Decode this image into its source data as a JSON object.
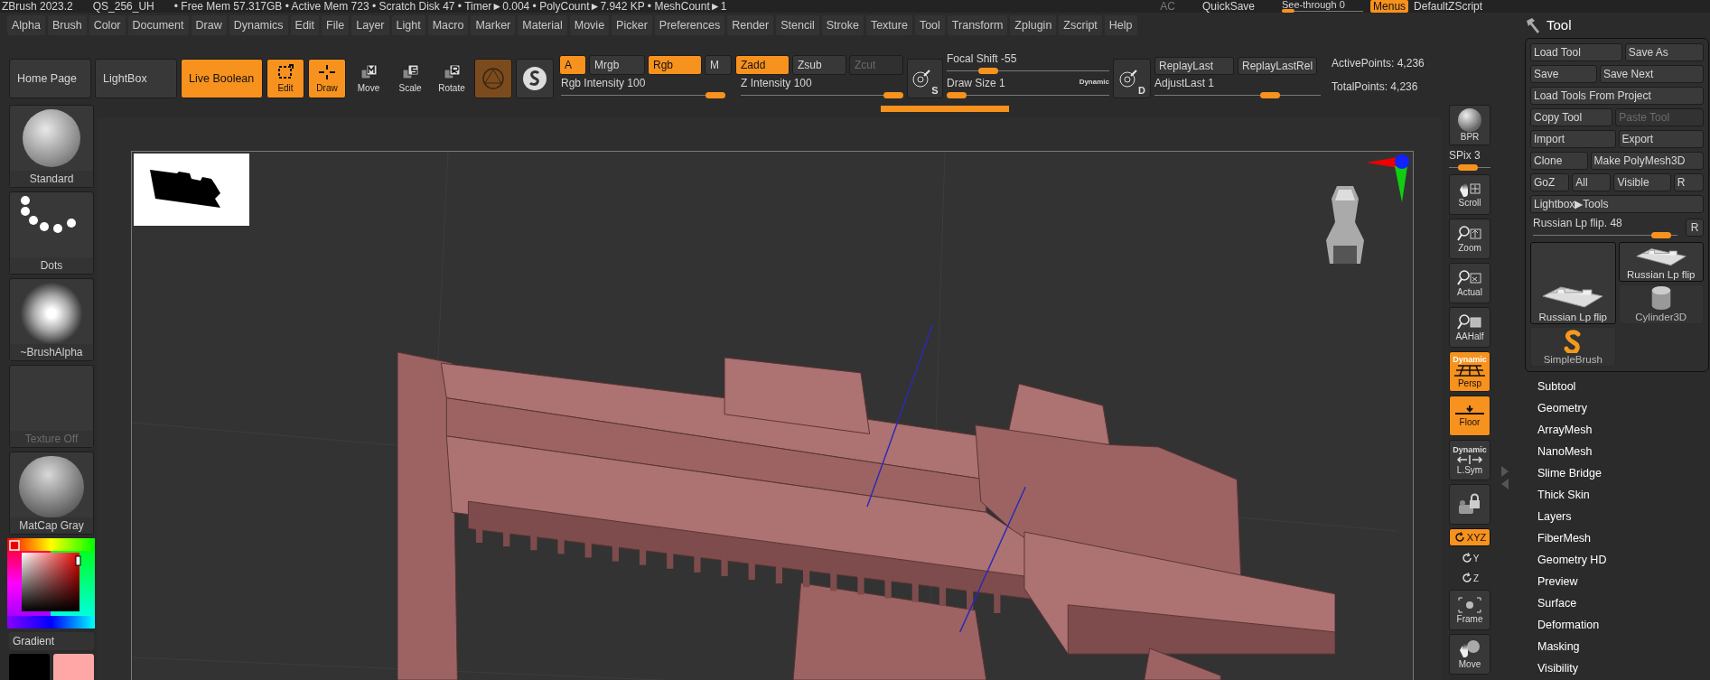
{
  "title_bar": {
    "app": "ZBrush 2023.2",
    "document": "QS_256_UH",
    "stats": "• Free Mem 57.317GB • Active Mem 723 • Scratch Disk 47 • Timer►0.004 • PolyCount►7.942 KP • MeshCount►1",
    "ac": "AC",
    "quicksave": "QuickSave",
    "see_through": {
      "label": "See-through  0",
      "level": 0
    },
    "menus": {
      "label": "Menus",
      "on": true
    },
    "script": "DefaultZScript"
  },
  "menu_bar": [
    "Alpha",
    "Brush",
    "Color",
    "Document",
    "Draw",
    "Dynamics",
    "Edit",
    "File",
    "Layer",
    "Light",
    "Macro",
    "Marker",
    "Material",
    "Movie",
    "Picker",
    "Preferences",
    "Render",
    "Stencil",
    "Stroke",
    "Texture",
    "Tool",
    "Transform",
    "Zplugin",
    "Zscript",
    "Help"
  ],
  "palette_title": "Tool",
  "shelf": {
    "nav": [
      {
        "label": "Home Page",
        "on": false
      },
      {
        "label": "LightBox",
        "on": false
      },
      {
        "label": "Live Boolean",
        "on": true
      }
    ],
    "modes": [
      {
        "kind": "edit",
        "label": "Edit",
        "on": true
      },
      {
        "kind": "draw",
        "label": "Draw",
        "on": true
      },
      {
        "kind": "move",
        "label": "Move",
        "on": false
      },
      {
        "kind": "scale",
        "label": "Scale",
        "on": false
      },
      {
        "kind": "rotate",
        "label": "Rotate",
        "on": false
      }
    ],
    "rgb_channels": [
      {
        "label": "A",
        "on": true,
        "disabled": false
      },
      {
        "label": "Mrgb",
        "on": false,
        "disabled": false
      },
      {
        "label": "Rgb",
        "on": true,
        "disabled": false
      },
      {
        "label": "M",
        "on": false,
        "disabled": false
      }
    ],
    "z_channels": [
      {
        "label": "Zadd",
        "on": true,
        "disabled": false
      },
      {
        "label": "Zsub",
        "on": false,
        "disabled": false
      },
      {
        "label": "Zcut",
        "on": false,
        "disabled": true
      }
    ],
    "rgb_intensity": {
      "label": "Rgb Intensity 100",
      "level": 1
    },
    "z_intensity": {
      "label": "Z Intensity 100",
      "level": 1
    },
    "focal_icon_letter": "S",
    "focal_shift": {
      "label": "Focal Shift -55",
      "level": 0.22
    },
    "draw_size": {
      "label": "Draw Size 1",
      "level": 0,
      "badge": "Dynamic"
    },
    "size_icon_letter": "D",
    "replay": [
      "ReplayLast",
      "ReplayLastRel"
    ],
    "adjust_last": {
      "label": "AdjustLast 1",
      "level": 0.72
    },
    "stats": [
      "ActivePoints: 4,236",
      "TotalPoints: 4,236"
    ]
  },
  "left_shelf": [
    {
      "kind": "brush",
      "label": "Standard",
      "disabled": false
    },
    {
      "kind": "stroke",
      "label": "Dots",
      "disabled": false
    },
    {
      "kind": "alpha",
      "label": "~BrushAlpha",
      "disabled": false
    },
    {
      "kind": "texture",
      "label": "Texture Off",
      "disabled": true
    },
    {
      "kind": "material",
      "label": "MatCap Gray",
      "disabled": false
    }
  ],
  "color_picker": {
    "label": "Gradient",
    "swatches": [
      {
        "color": "#000000"
      },
      {
        "color": "#ffa6a6"
      }
    ]
  },
  "right_shelf": [
    {
      "kind": "bpr",
      "label": "BPR",
      "on": false
    },
    {
      "kind": "spix",
      "label": "SPix 3",
      "level": 0.4
    },
    {
      "kind": "scroll",
      "label": "Scroll",
      "on": false
    },
    {
      "kind": "zoom",
      "label": "Zoom",
      "on": false
    },
    {
      "kind": "actual",
      "label": "Actual",
      "on": false
    },
    {
      "kind": "aahalf",
      "label": "AAHalf",
      "on": false
    },
    {
      "kind": "persp",
      "label": "Persp",
      "on": true,
      "badge": "Dynamic"
    },
    {
      "kind": "floor",
      "label": "Floor",
      "on": true
    },
    {
      "kind": "lsym",
      "label": "L.Sym",
      "on": false,
      "badge": "Dynamic"
    },
    {
      "kind": "camera",
      "on": false
    },
    {
      "kind": "xyz",
      "label": "XYZ",
      "on": true
    },
    {
      "kind": "rot",
      "label": "Y",
      "on": false
    },
    {
      "kind": "rot",
      "label": "Z",
      "on": false
    },
    {
      "kind": "frame",
      "label": "Frame",
      "on": false
    },
    {
      "kind": "move",
      "label": "Move",
      "on": false
    }
  ],
  "tool_panel": {
    "rows": [
      [
        {
          "label": "Load Tool",
          "disabled": false
        },
        {
          "label": "Save As",
          "disabled": false
        }
      ],
      [
        {
          "label": "Save",
          "disabled": false
        },
        {
          "label": "Save Next",
          "disabled": false
        }
      ],
      [
        {
          "label": "Load Tools From Project",
          "disabled": false
        }
      ],
      [
        {
          "label": "Copy Tool",
          "disabled": false
        },
        {
          "label": "Paste Tool",
          "disabled": true
        }
      ],
      [
        {
          "label": "Import",
          "disabled": false
        },
        {
          "label": "Export",
          "disabled": false
        }
      ],
      [
        {
          "label": "Clone",
          "disabled": false
        },
        {
          "label": "Make PolyMesh3D",
          "disabled": false
        }
      ],
      [
        {
          "label": "GoZ",
          "disabled": false
        },
        {
          "label": "All",
          "disabled": false
        },
        {
          "label": "Visible",
          "disabled": false
        },
        {
          "label": "R",
          "disabled": false
        }
      ],
      [
        {
          "label": "Lightbox▶Tools",
          "disabled": false
        }
      ]
    ],
    "tool_slider": {
      "label": "Russian Lp flip. 48",
      "level": 0.95,
      "reset": "R"
    },
    "tools": [
      {
        "kind": "building",
        "label": "Russian Lp flip",
        "selected": true
      },
      {
        "kind": "building",
        "label": "Russian Lp flip",
        "selected": true
      },
      {
        "kind": "cylinder",
        "label": "Cylinder3D",
        "selected": false
      },
      {
        "kind": "brush",
        "label": "SimpleBrush",
        "selected": false
      }
    ],
    "subpalettes": [
      "Subtool",
      "Geometry",
      "ArrayMesh",
      "NanoMesh",
      "Slime Bridge",
      "Thick Skin",
      "Layers",
      "FiberMesh",
      "Geometry HD",
      "Preview",
      "Surface",
      "Deformation",
      "Masking",
      "Visibility"
    ]
  }
}
